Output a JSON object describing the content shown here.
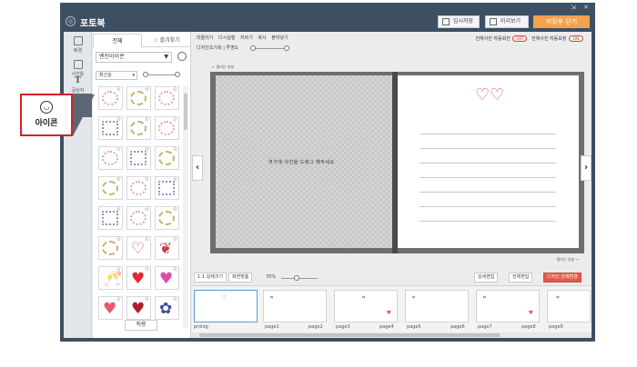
{
  "window": {
    "controls": "⇲ ✕"
  },
  "app": {
    "title": "포토북",
    "buttons": {
      "temp_save": "임시저장",
      "preview": "미리보기",
      "save_close": "저장후 닫기"
    }
  },
  "rail": {
    "items": [
      {
        "label": "배경"
      },
      {
        "label": "사진틀"
      },
      {
        "label": "글상자",
        "glyph": "T"
      },
      {
        "label": "아이콘"
      }
    ]
  },
  "panel": {
    "tabs": [
      "전체",
      "즐겨찾기"
    ],
    "category": "엔진아이콘",
    "sort": "최신순",
    "apply": "적용"
  },
  "editor": {
    "toolbar1": [
      "되돌리기",
      "다시실행",
      "자르기",
      "복사",
      "붙여넣기"
    ],
    "toolbar2": {
      "label": "디자인초기화",
      "opacity_label": "투명도"
    },
    "right": {
      "auto_fit": "전체사진 자동회전",
      "auto_fit_state": "OFF",
      "auto_correct": "전체사진 자동보정",
      "auto_correct_state": "ON"
    },
    "left_caption": "← 잘리는 부분",
    "right_caption": "잘리는 부분 →",
    "hint": "여기에 사진을 드래그 해주세요",
    "bottom": {
      "fit": "1:1 실제크기",
      "full": "화면맞춤",
      "zoom": "70%",
      "detail_edit": "상세편집",
      "all_edit": "전체편집",
      "design_change": "디자인 전체변경"
    }
  },
  "thumbs": {
    "labels": [
      "prolog",
      "page1",
      "page2",
      "page3",
      "page4",
      "page5",
      "page6",
      "page7",
      "page8",
      "page9"
    ]
  },
  "tooltip": {
    "label": "아이콘"
  },
  "colors": {
    "accent_orange": "#f5a04b",
    "tooltip_border": "#d2232a",
    "design_btn": "#e05a4c",
    "chrome": "#3d4f63"
  }
}
